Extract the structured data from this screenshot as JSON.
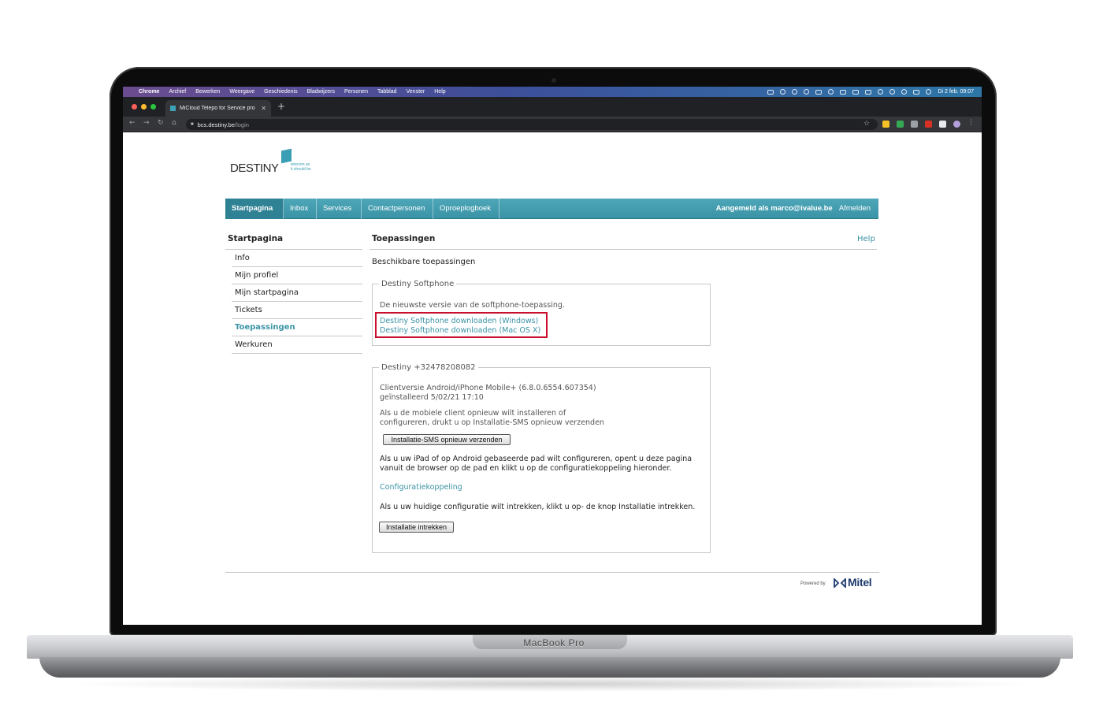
{
  "device": {
    "brand": "MacBook Pro"
  },
  "menubar": {
    "items": [
      "Chrome",
      "Archief",
      "Bewerken",
      "Weergave",
      "Geschiedenis",
      "Bladwijzers",
      "Personen",
      "Tabblad",
      "Venster",
      "Help"
    ],
    "clock": "Di 2 feb. 09:07"
  },
  "browser": {
    "tab_title": "MiCloud Telepo for Service pro",
    "url_host": "bcs.destiny.be",
    "url_path": "/login"
  },
  "logo": {
    "wordmark": "DESTINY",
    "tagline_1": "telecom as",
    "tagline_2": "it should be"
  },
  "nav": {
    "items": [
      "Startpagina",
      "Inbox",
      "Services",
      "Contactpersonen",
      "Oproeplogboek"
    ],
    "user": "Aangemeld als marco@ivalue.be",
    "logout": "Afmelden"
  },
  "sidebar": {
    "title": "Startpagina",
    "items": [
      "Info",
      "Mijn profiel",
      "Mijn startpagina",
      "Tickets",
      "Toepassingen",
      "Werkuren"
    ]
  },
  "main": {
    "title": "Toepassingen",
    "help": "Help",
    "subtitle": "Beschikbare toepassingen",
    "softphone": {
      "legend": "Destiny Softphone",
      "description": "De nieuwste versie van de softphone-toepassing.",
      "link_windows": "Destiny Softphone downloaden (Windows)",
      "link_mac": "Destiny Softphone downloaden (Mac OS X)"
    },
    "mobile": {
      "legend": "Destiny +32478208082",
      "version": "Clientversie Android/iPhone Mobile+ (6.8.0.6554.607354)",
      "installed": "geïnstalleerd 5/02/21 17:10",
      "reinstall_1": "Als u de mobiele client opnieuw wilt installeren of",
      "reinstall_2": "configureren, drukt u op Installatie-SMS opnieuw verzenden",
      "sms_button": "Installatie-SMS opnieuw verzenden",
      "ipad_1": "Als u uw iPad of op Android gebaseerde pad wilt configureren, opent u deze pagina",
      "ipad_2": "vanuit de browser op de pad en klikt u op de configuratiekoppeling hieronder.",
      "config_link": "Configuratiekoppeling",
      "revoke_text": "Als u uw huidige configuratie wilt intrekken, klikt u op- de knop Installatie intrekken.",
      "revoke_button": "Installatie intrekken"
    }
  },
  "footer": {
    "powered_by": "Powered by",
    "brand": "Mitel"
  },
  "colors": {
    "accent": "#3a93a6",
    "highlight": "#c8102e",
    "mitel": "#1e3a6e"
  }
}
